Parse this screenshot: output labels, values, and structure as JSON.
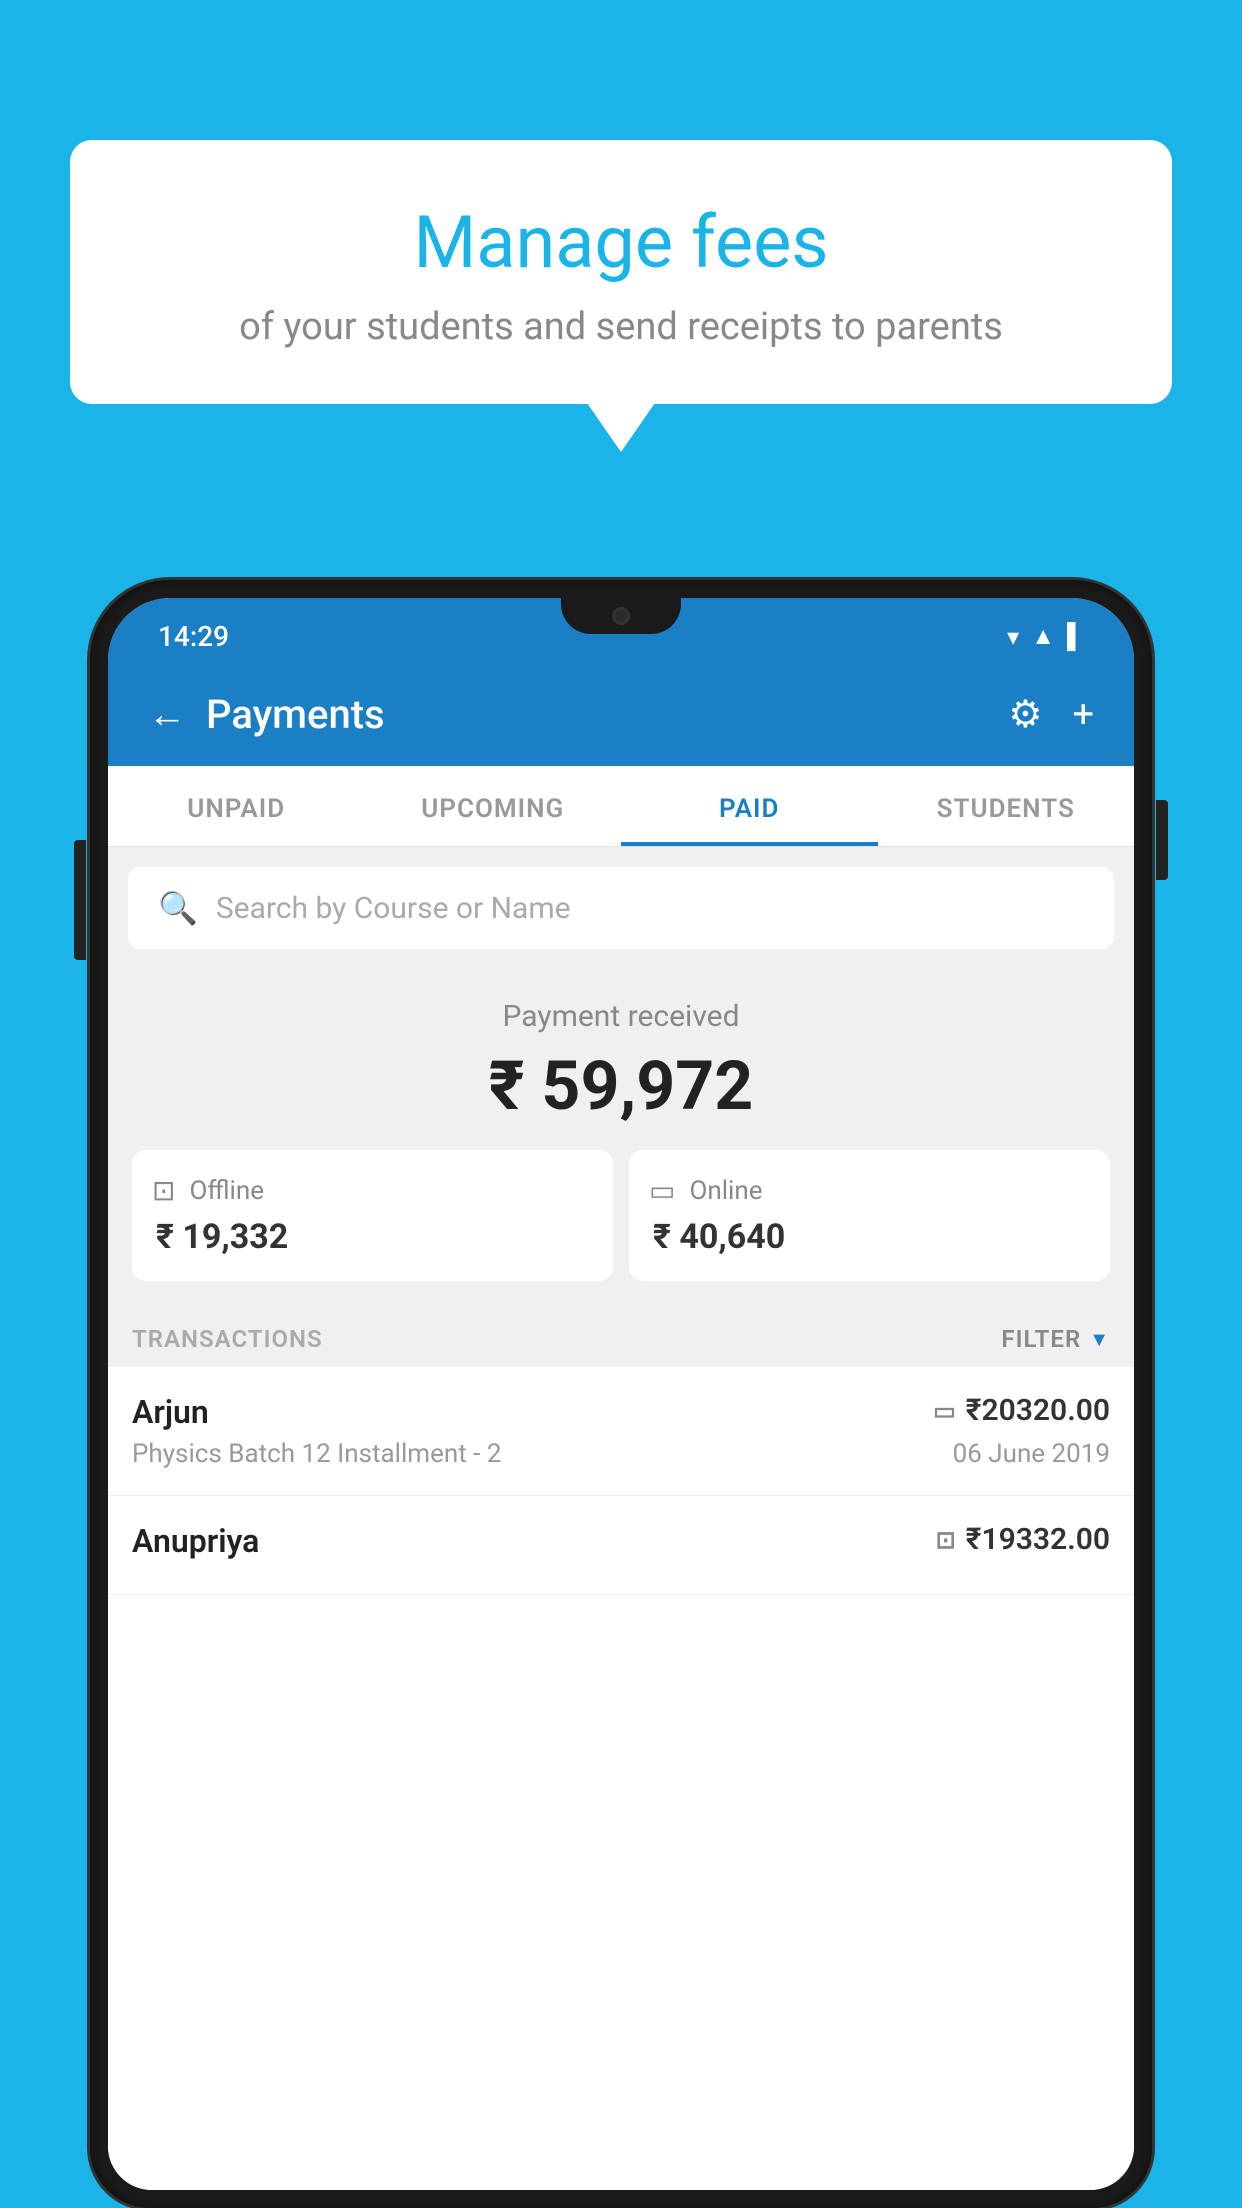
{
  "background_color": "#1ab4e8",
  "speech_bubble": {
    "title": "Manage fees",
    "subtitle": "of your students and send receipts to parents"
  },
  "status_bar": {
    "time": "14:29",
    "icons": [
      "wifi",
      "signal",
      "battery"
    ]
  },
  "app_header": {
    "title": "Payments",
    "back_label": "←",
    "settings_label": "⚙",
    "add_label": "+"
  },
  "tabs": [
    {
      "label": "UNPAID",
      "active": false
    },
    {
      "label": "UPCOMING",
      "active": false
    },
    {
      "label": "PAID",
      "active": true
    },
    {
      "label": "STUDENTS",
      "active": false
    }
  ],
  "search": {
    "placeholder": "Search by Course or Name"
  },
  "payment_summary": {
    "label": "Payment received",
    "total": "₹ 59,972",
    "offline": {
      "label": "Offline",
      "amount": "₹ 19,332"
    },
    "online": {
      "label": "Online",
      "amount": "₹ 40,640"
    }
  },
  "transactions_header": {
    "label": "TRANSACTIONS",
    "filter_label": "FILTER"
  },
  "transactions": [
    {
      "name": "Arjun",
      "amount": "₹20320.00",
      "course": "Physics Batch 12 Installment - 2",
      "date": "06 June 2019",
      "payment_type": "online"
    },
    {
      "name": "Anupriya",
      "amount": "₹19332.00",
      "course": "",
      "date": "",
      "payment_type": "offline"
    }
  ]
}
